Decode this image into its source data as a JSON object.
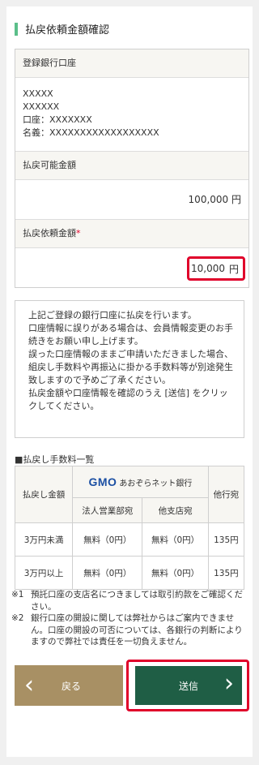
{
  "title": "払戻依頼金額確認",
  "bank_account": {
    "label": "登録銀行口座",
    "bank_name": "XXXXX",
    "branch_name": "XXXXXX",
    "account_number": "口座：XXXXXXX",
    "account_holder": "名義：XXXXXXXXXXXXXXXXXX"
  },
  "available": {
    "label": "払戻可能金額",
    "value": "100,000 円"
  },
  "request": {
    "label": "払戻依頼金額",
    "required_mark": "*",
    "amount": "10,000",
    "unit": "円"
  },
  "notice": [
    "上記ご登録の銀行口座に払戻を行います。",
    "口座情報に誤りがある場合は、会員情報変更のお手続きをお願い申し上げます。",
    "誤った口座情報のままご申請いただきました場合、組戻し手数料や再振込に掛かる手数料等が別途発生致しますので予めご了承ください。",
    "払戻金額や口座情報を確認のうえ [送信] をクリックしてください。"
  ],
  "fee_table": {
    "heading": "■払戻し手数料一覧",
    "col_amount": "払戻し金額",
    "bank_logo": "GMO",
    "bank_name": "あおぞらネット銀行",
    "col_corporate": "法人営業部宛",
    "col_other_branch": "他支店宛",
    "col_other_bank": "他行宛",
    "rows": [
      {
        "amount": "3万円未満",
        "corporate": "無料（0円）",
        "other_branch": "無料（0円）",
        "other_bank": "135円"
      },
      {
        "amount": "3万円以上",
        "corporate": "無料（0円）",
        "other_branch": "無料（0円）",
        "other_bank": "135円"
      }
    ]
  },
  "footnotes": [
    {
      "mark": "※1",
      "text": "預託口座の支店名につきましては取引約款をご確認ください。"
    },
    {
      "mark": "※2",
      "text": "銀行口座の開設に関しては弊社からはご案内できません。口座の開設の可否については、各銀行の判断によりますので弊社では責任を一切負えません。"
    }
  ],
  "buttons": {
    "back": "戻る",
    "send": "送信"
  }
}
